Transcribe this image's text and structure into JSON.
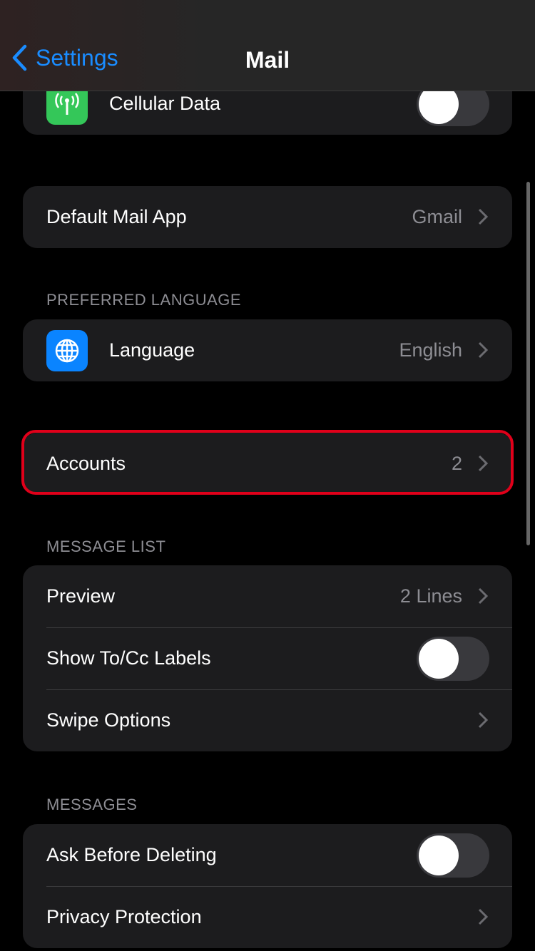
{
  "nav": {
    "back_label": "Settings",
    "title": "Mail"
  },
  "groups": {
    "cellular": {
      "label": "Cellular Data",
      "icon": "antenna-icon",
      "icon_color": "#34c759",
      "toggle_on": false
    },
    "default_mail": {
      "label": "Default Mail App",
      "value": "Gmail"
    },
    "preferred_language_header": "PREFERRED LANGUAGE",
    "language": {
      "label": "Language",
      "value": "English",
      "icon": "globe-icon",
      "icon_color": "#0a84ff"
    },
    "accounts": {
      "label": "Accounts",
      "value": "2",
      "highlight_color": "#e0001a"
    },
    "message_list_header": "MESSAGE LIST",
    "message_list": [
      {
        "label": "Preview",
        "value": "2 Lines"
      },
      {
        "label": "Show To/Cc Labels",
        "toggle_on": false
      },
      {
        "label": "Swipe Options"
      }
    ],
    "messages_header": "MESSAGES",
    "messages": [
      {
        "label": "Ask Before Deleting",
        "toggle_on": false
      },
      {
        "label": "Privacy Protection"
      }
    ]
  },
  "colors": {
    "accent": "#1a8cff",
    "background": "#000000",
    "cell": "#1c1c1e"
  }
}
